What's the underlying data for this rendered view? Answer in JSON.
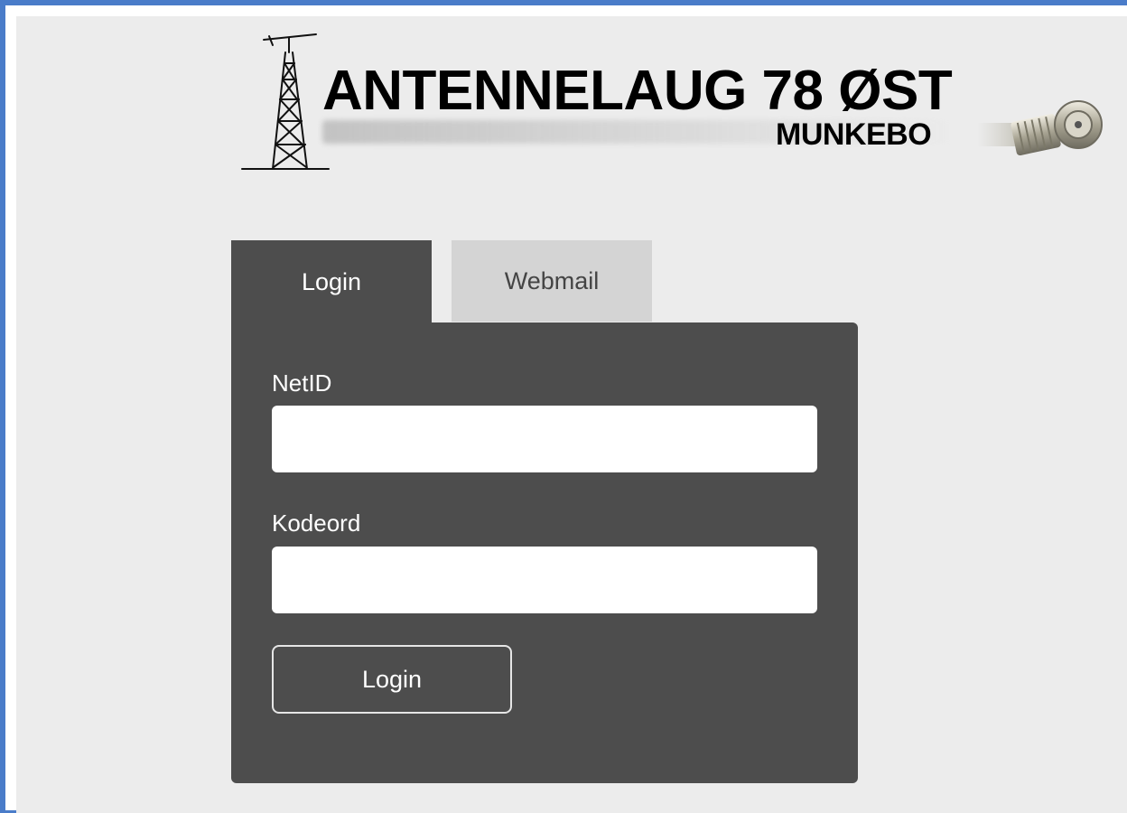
{
  "header": {
    "title": "ANTENNELAUG 78 ØST",
    "subtitle": "MUNKEBO",
    "logo_icons": [
      "antenna-tower-icon",
      "coax-connector-icon"
    ]
  },
  "tabs": [
    {
      "label": "Login",
      "active": true
    },
    {
      "label": "Webmail",
      "active": false
    }
  ],
  "form": {
    "netid_label": "NetID",
    "netid_value": "",
    "password_label": "Kodeord",
    "password_value": "",
    "submit_label": "Login"
  },
  "colors": {
    "panel": "#4d4d4d",
    "inactive_tab": "#d4d4d4",
    "page_background": "#ececec",
    "frame_border": "#4a7cc9"
  }
}
